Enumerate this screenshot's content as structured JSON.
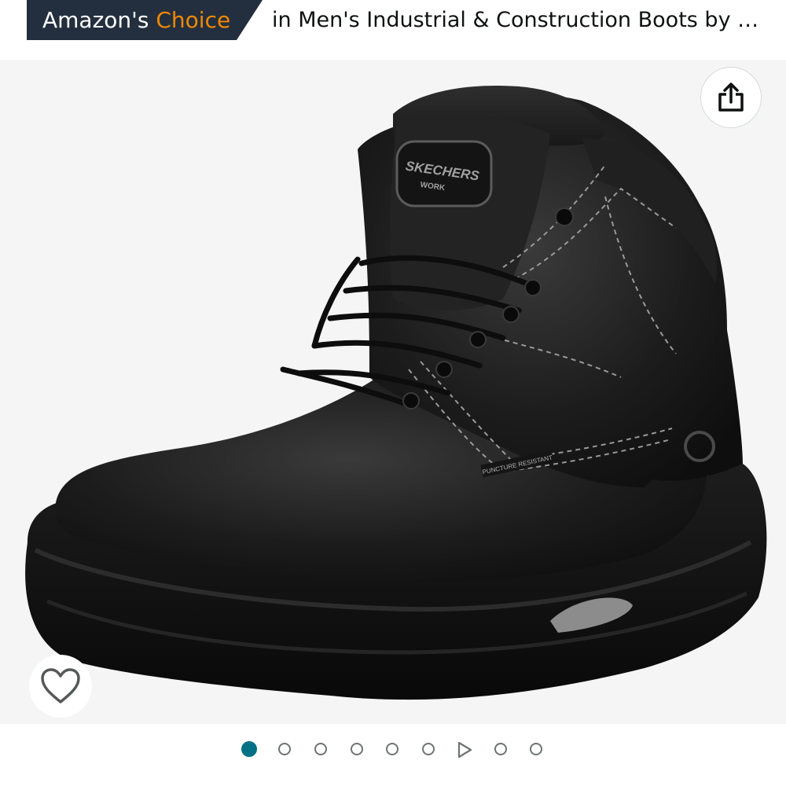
{
  "badge": {
    "prefix": "Amazon's",
    "highlight": "Choice"
  },
  "category_text": "in Men's Industrial & Construction Boots by …",
  "product_image": {
    "alt": "Skechers Work black leather boot",
    "logo_text": "SKECHERS",
    "logo_subtext": "WORK",
    "tag_text": "PUNCTURE RESISTANT"
  },
  "icons": {
    "share": "share-icon",
    "favorite": "heart-icon",
    "video": "play-icon"
  },
  "carousel": {
    "count": 9,
    "active_index": 0,
    "video_index": 6
  },
  "colors": {
    "badge_bg": "#232f3e",
    "choice_orange": "#f08804",
    "active_dot": "#007185"
  }
}
